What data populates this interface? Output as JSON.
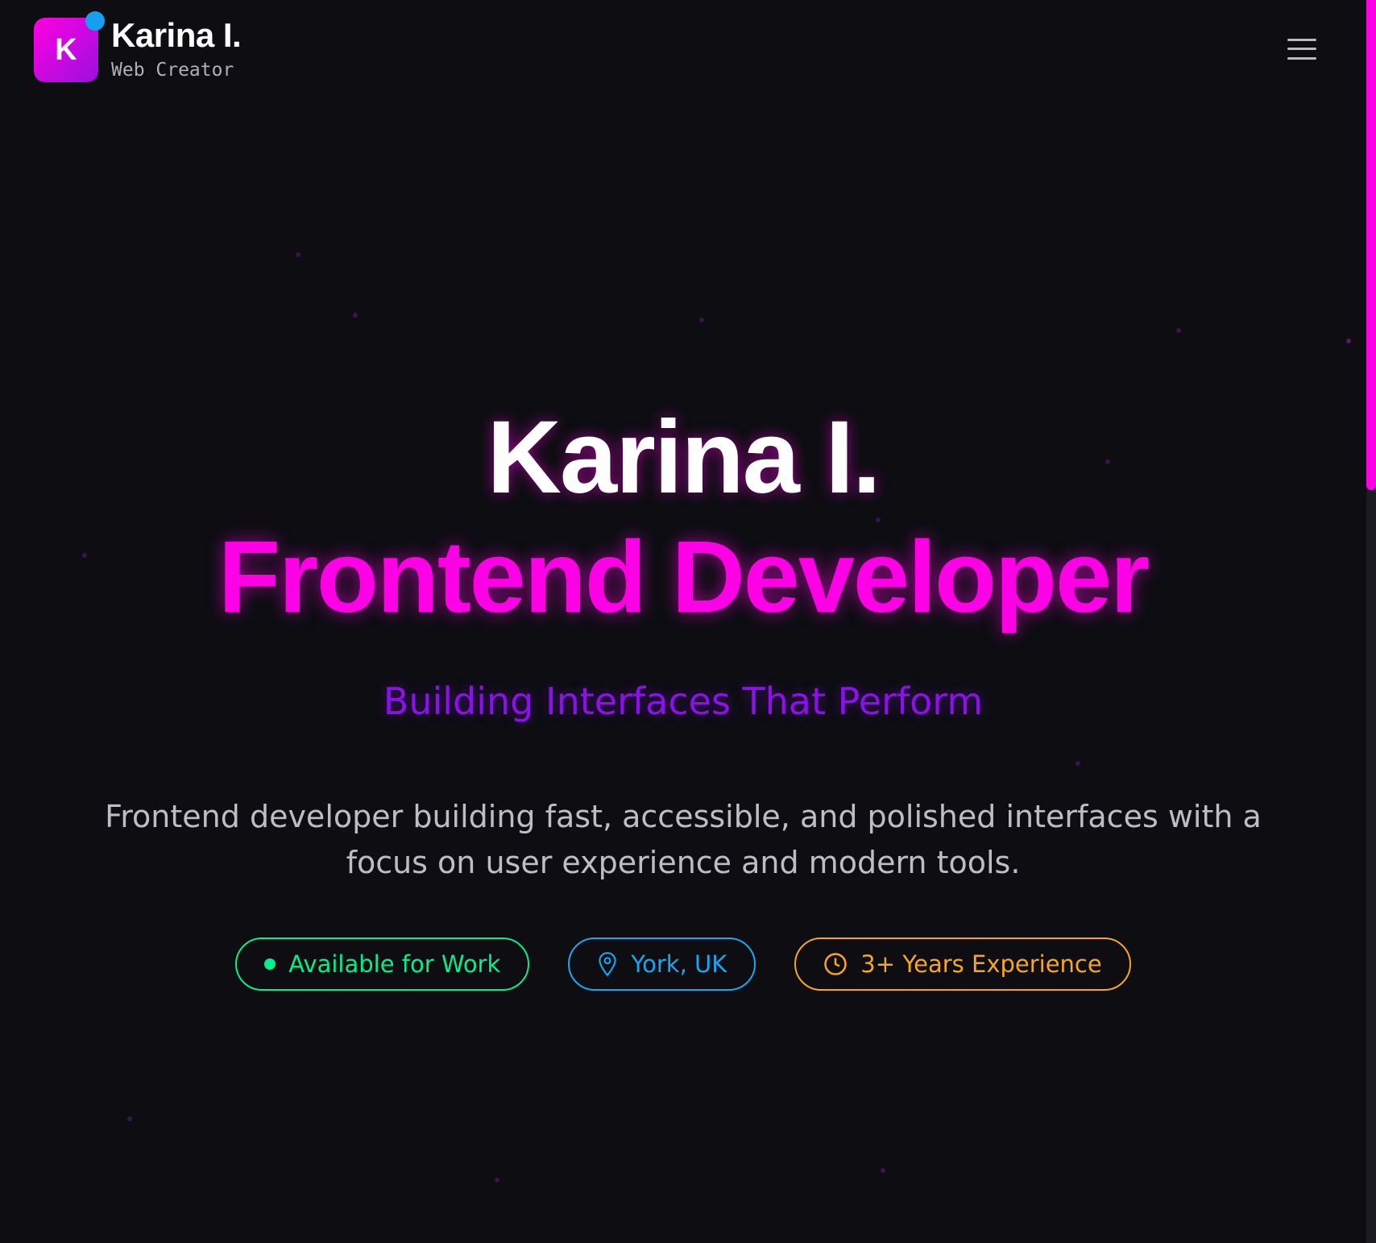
{
  "header": {
    "logo_letter": "K",
    "brand_name": "Karina I.",
    "brand_subtitle": "Web Creator",
    "menu_icon": "hamburger-icon"
  },
  "hero": {
    "name": "Karina I.",
    "role": "Frontend Developer",
    "tagline": "Building Interfaces That Perform",
    "description": "Frontend developer building fast, accessible, and polished interfaces with a focus on user experience and modern tools."
  },
  "badges": [
    {
      "label": "Available for Work",
      "icon": "status-dot-icon",
      "color": "#00f090"
    },
    {
      "label": "York, UK",
      "icon": "map-pin-icon",
      "color": "#14a8f0"
    },
    {
      "label": "3+ Years Experience",
      "icon": "clock-icon",
      "color": "#f5a623"
    }
  ],
  "colors": {
    "background": "#0d0d12",
    "accent": "#ff00e6",
    "secondary": "#8a12e6"
  }
}
